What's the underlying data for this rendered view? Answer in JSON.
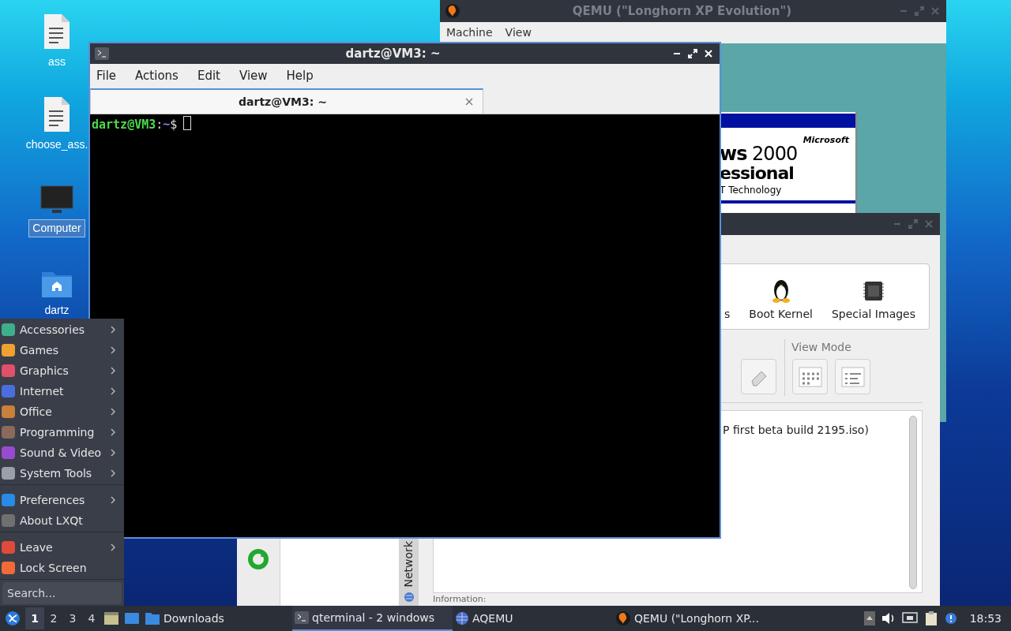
{
  "desktop_icons": [
    {
      "label": "ass",
      "kind": "document",
      "selected": false
    },
    {
      "label": "choose_ass.",
      "kind": "document",
      "selected": false
    },
    {
      "label": "Computer",
      "kind": "monitor",
      "selected": true
    },
    {
      "label": "dartz",
      "kind": "folder",
      "selected": false
    }
  ],
  "qemu_window": {
    "title": "QEMU (\"Longhorn XP Evolution\")",
    "menu": [
      "Machine",
      "View"
    ],
    "guest_screen": {
      "brand": "Microsoft",
      "product": "**ws** 2000",
      "edition": "essional",
      "tagline": "T Technology"
    }
  },
  "aqemu_window": {
    "toolbar_items": [
      {
        "label": "s",
        "kind": "none"
      },
      {
        "label": "Boot Kernel",
        "kind": "penguin"
      },
      {
        "label": "Special Images",
        "kind": "chip"
      }
    ],
    "view_mode_label": "View Mode",
    "list_item": "P first beta build 2195.iso)",
    "side_tab": "Network",
    "info_label": "Information:"
  },
  "terminal_window": {
    "title": "dartz@VM3: ~",
    "menu": [
      "File",
      "Actions",
      "Edit",
      "View",
      "Help"
    ],
    "tab": {
      "label": "dartz@VM3: ~",
      "selected": true
    },
    "prompt_user": "dartz@VM3",
    "prompt_sep": ":",
    "prompt_path": "~",
    "prompt_symbol": "$"
  },
  "start_menu": {
    "sections": [
      [
        {
          "label": "Accessories",
          "color": "#3fae8c",
          "submenu": true
        },
        {
          "label": "Games",
          "color": "#f0a030",
          "submenu": true
        },
        {
          "label": "Graphics",
          "color": "#e0506a",
          "submenu": true
        },
        {
          "label": "Internet",
          "color": "#4a6ee0",
          "submenu": true
        },
        {
          "label": "Office",
          "color": "#c8803a",
          "submenu": true
        },
        {
          "label": "Programming",
          "color": "#8a6a5a",
          "submenu": true
        },
        {
          "label": "Sound & Video",
          "color": "#9a4ad0",
          "submenu": true
        },
        {
          "label": "System Tools",
          "color": "#9aa0aa",
          "submenu": true
        }
      ],
      [
        {
          "label": "Preferences",
          "color": "#2a8ae8",
          "submenu": true
        },
        {
          "label": "About LXQt",
          "color": "#707070",
          "submenu": false
        }
      ],
      [
        {
          "label": "Leave",
          "color": "#e04a3a",
          "submenu": true
        },
        {
          "label": "Lock Screen",
          "color": "#f06a3a",
          "submenu": false
        }
      ]
    ],
    "search_placeholder": "Search..."
  },
  "taskbar": {
    "desktops": [
      {
        "label": "1",
        "selected": true
      },
      {
        "label": "2",
        "selected": false
      },
      {
        "label": "3",
        "selected": false
      },
      {
        "label": "4",
        "selected": false
      }
    ],
    "tasks": [
      {
        "label": "Downloads",
        "kind": "folder",
        "selected": false
      },
      {
        "label": "qterminal - 2 windows",
        "kind": "terminal",
        "selected": true
      },
      {
        "label": "AQEMU",
        "kind": "globe",
        "selected": false
      },
      {
        "label": "QEMU (\"Longhorn XP...",
        "kind": "qemu",
        "selected": false
      }
    ],
    "clock": "18:53"
  }
}
